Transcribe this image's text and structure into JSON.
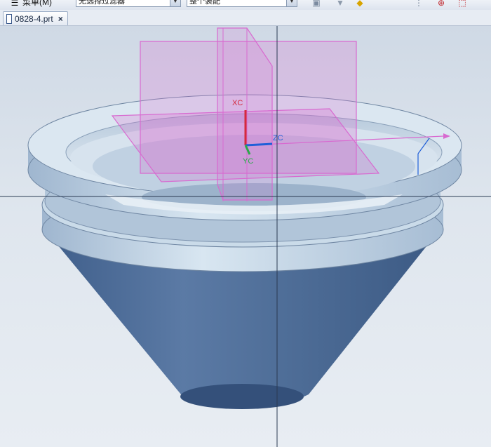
{
  "toolbar": {
    "menu_label": "菜单(M)",
    "filter_select": "无选择过滤器",
    "scope_select": "整个装配"
  },
  "tab": {
    "file_name": "0828-4.prt",
    "close_glyph": "×"
  },
  "viewport": {
    "csys_labels": {
      "x": "XC",
      "y": "YC",
      "z": "ZC"
    },
    "colors": {
      "body_dark": "#4d6b95",
      "rim_light": "#c4d6e6",
      "datum_plane": "#d86ad0",
      "x_axis": "#d42a3c",
      "y_axis": "#2aa84a",
      "z_axis": "#1f5fd8"
    }
  }
}
